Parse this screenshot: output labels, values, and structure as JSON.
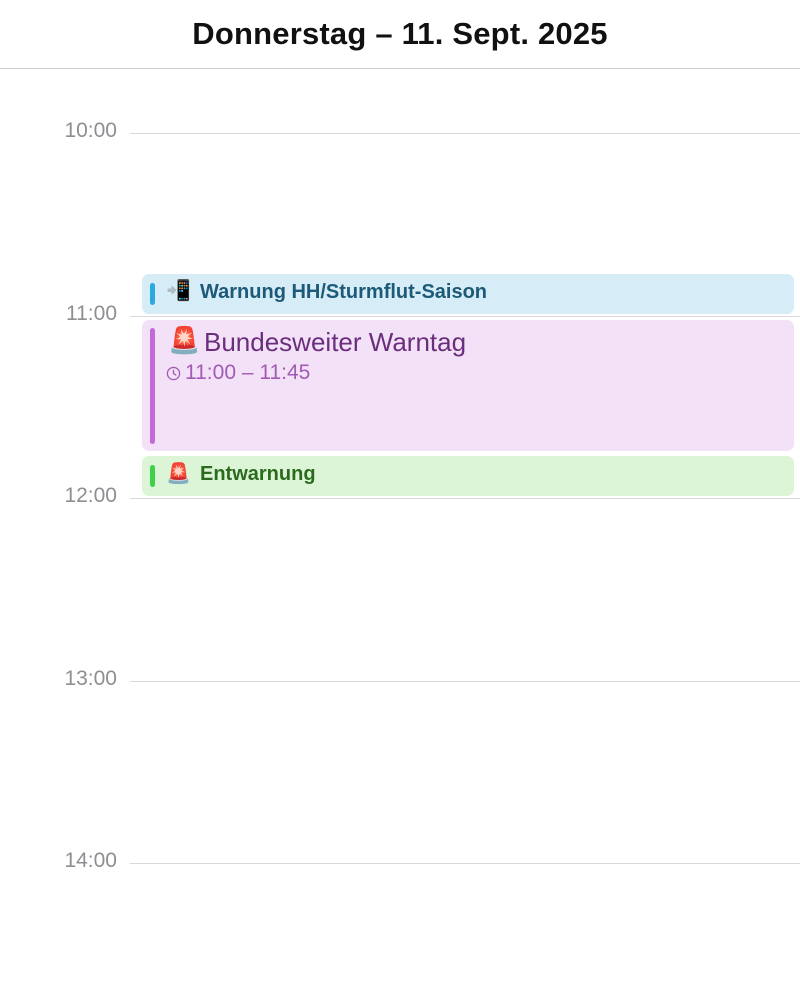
{
  "header": {
    "title": "Donnerstag – 11. Sept. 2025"
  },
  "timeline": {
    "hours": [
      "10:00",
      "11:00",
      "12:00",
      "13:00",
      "14:00"
    ]
  },
  "events": [
    {
      "emoji": "📲",
      "icon": "mobile-phone-incoming-icon",
      "title": "Warnung HH/Sturmflut-Saison",
      "color": "#2aa8e0",
      "background": "#d6ecf7"
    },
    {
      "emoji": "🚨",
      "icon": "police-light-icon",
      "title": "Bundesweiter Warntag",
      "time": "11:00 – 11:45",
      "color": "#c36ad9",
      "background": "#f3e1f7"
    },
    {
      "emoji": "🚨",
      "icon": "police-light-icon",
      "title": "Entwarnung",
      "color": "#3fd14a",
      "background": "#dcf5d6"
    }
  ]
}
